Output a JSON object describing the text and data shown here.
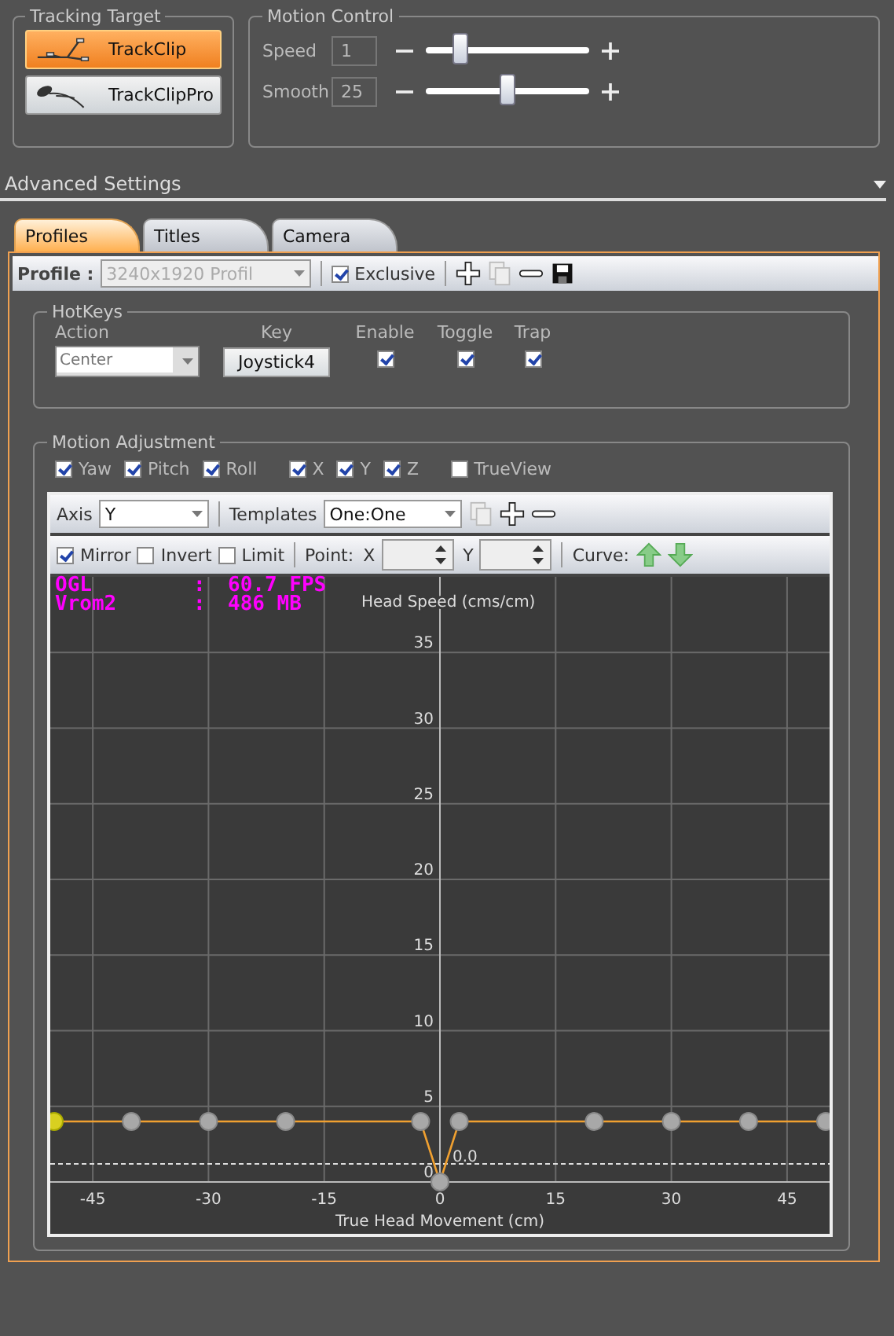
{
  "tracking_target": {
    "title": "Tracking Target",
    "options": [
      {
        "label": "TrackClip",
        "selected": true
      },
      {
        "label": "TrackClipPro",
        "selected": false
      }
    ]
  },
  "motion_control": {
    "title": "Motion Control",
    "sliders": [
      {
        "label": "Speed",
        "value": "1",
        "level": 0.21
      },
      {
        "label": "Smooth",
        "value": "25",
        "level": 0.5
      }
    ]
  },
  "advanced": {
    "title": "Advanced Settings"
  },
  "tabs": [
    {
      "label": "Profiles",
      "selected": true
    },
    {
      "label": "Titles",
      "selected": false
    },
    {
      "label": "Camera",
      "selected": false
    }
  ],
  "profile_bar": {
    "label": "Profile :",
    "profile": "3240x1920 Profil",
    "exclusive": {
      "label": "Exclusive",
      "checked": true
    }
  },
  "hotkeys": {
    "title": "HotKeys",
    "columns": [
      "Action",
      "Key",
      "Enable",
      "Toggle",
      "Trap"
    ],
    "action": {
      "placeholder": "Center"
    },
    "key": "Joystick4",
    "enable": true,
    "toggle": true,
    "trap": true
  },
  "motion_adjustment": {
    "title": "Motion Adjustment",
    "axes": [
      {
        "label": "Yaw",
        "checked": true
      },
      {
        "label": "Pitch",
        "checked": true
      },
      {
        "label": "Roll",
        "checked": true
      },
      {
        "label": "X",
        "checked": true
      },
      {
        "label": "Y",
        "checked": true
      },
      {
        "label": "Z",
        "checked": true
      },
      {
        "label": "TrueView",
        "checked": false
      }
    ]
  },
  "graph": {
    "axis_label": "Axis",
    "axis": "Y",
    "templates_label": "Templates",
    "template": "One:One",
    "options": [
      {
        "label": "Mirror",
        "checked": true
      },
      {
        "label": "Invert",
        "checked": false
      },
      {
        "label": "Limit",
        "checked": false
      }
    ],
    "point_label": "Point:",
    "x_label": "X",
    "y_label": "Y",
    "curve_label": "Curve:",
    "overlay": [
      [
        "OGL",
        ":",
        "60.7 FPS"
      ],
      [
        "Vrom2",
        ":",
        "486 MB"
      ]
    ],
    "point_selected": [
      true,
      false,
      false,
      false,
      false,
      false,
      false,
      false,
      false,
      false,
      false
    ],
    "chart_data": {
      "type": "line",
      "xlabel": "True Head Movement (cm)",
      "ylabel": "Head Speed (cms/cm)",
      "x": [
        -50,
        -40,
        -30,
        -20,
        -2.5,
        0,
        2.5,
        20,
        30,
        40,
        50
      ],
      "series": [
        {
          "color": "#f0a030",
          "marker": "circle",
          "values": [
            4,
            4,
            4,
            4,
            4,
            0,
            4,
            4,
            4,
            4,
            4
          ]
        }
      ],
      "xlim": [
        -50,
        50
      ],
      "ylim": [
        0,
        40
      ],
      "xticks": [
        -45,
        -30,
        -15,
        0,
        15,
        30,
        45
      ],
      "yticks": [
        0,
        5,
        10,
        15,
        20,
        25,
        30,
        35
      ],
      "grid": true,
      "ref_lines": [
        {
          "axis": "y",
          "value": 1.2
        }
      ]
    },
    "dead_zone_label": "0.0"
  }
}
